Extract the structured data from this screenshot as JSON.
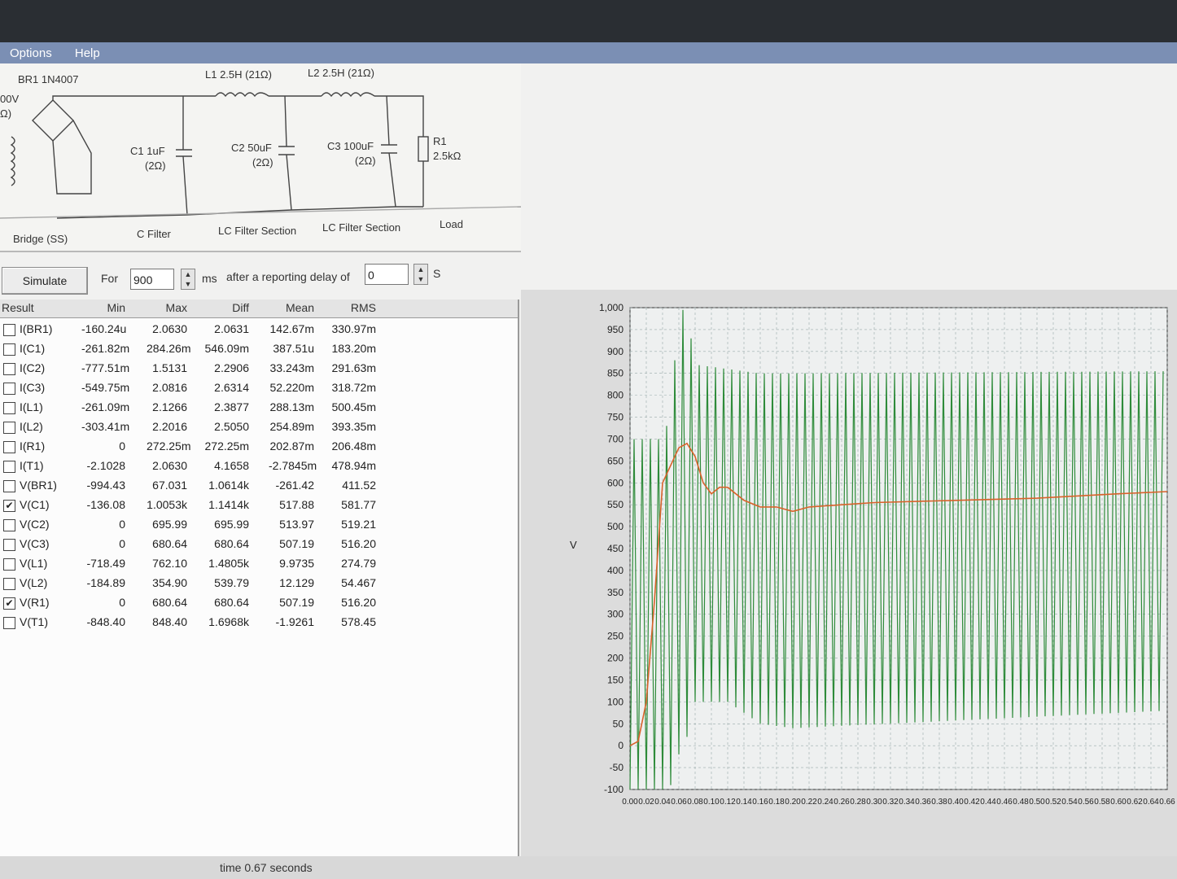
{
  "menu": {
    "items": [
      "Options",
      "Help"
    ]
  },
  "schematic": {
    "br1": "BR1 1N4007",
    "src_v": "00V",
    "src_r": "Ω)",
    "l1": "L1 2.5H (21Ω)",
    "l2": "L2 2.5H (21Ω)",
    "c1": "C1 1uF",
    "c1r": "(2Ω)",
    "c2": "C2 50uF",
    "c2r": "(2Ω)",
    "c3": "C3 100uF",
    "c3r": "(2Ω)",
    "r1": "R1",
    "r1v": "2.5kΩ",
    "sections": [
      "Bridge (SS)",
      "C Filter",
      "LC Filter Section",
      "LC Filter Section",
      "Load"
    ]
  },
  "toolbar": {
    "simulate": "Simulate",
    "for": "For",
    "duration": "900",
    "ms": "ms",
    "after": "after a reporting delay of",
    "delay": "0",
    "s": "S"
  },
  "results": {
    "headers": [
      "Result",
      "Min",
      "Max",
      "Diff",
      "Mean",
      "RMS"
    ],
    "rows": [
      {
        "name": "I(BR1)",
        "checked": false,
        "min": "-160.24u",
        "max": "2.0630",
        "diff": "2.0631",
        "mean": "142.67m",
        "rms": "330.97m"
      },
      {
        "name": "I(C1)",
        "checked": false,
        "min": "-261.82m",
        "max": "284.26m",
        "diff": "546.09m",
        "mean": "387.51u",
        "rms": "183.20m"
      },
      {
        "name": "I(C2)",
        "checked": false,
        "min": "-777.51m",
        "max": "1.5131",
        "diff": "2.2906",
        "mean": "33.243m",
        "rms": "291.63m"
      },
      {
        "name": "I(C3)",
        "checked": false,
        "min": "-549.75m",
        "max": "2.0816",
        "diff": "2.6314",
        "mean": "52.220m",
        "rms": "318.72m"
      },
      {
        "name": "I(L1)",
        "checked": false,
        "min": "-261.09m",
        "max": "2.1266",
        "diff": "2.3877",
        "mean": "288.13m",
        "rms": "500.45m"
      },
      {
        "name": "I(L2)",
        "checked": false,
        "min": "-303.41m",
        "max": "2.2016",
        "diff": "2.5050",
        "mean": "254.89m",
        "rms": "393.35m"
      },
      {
        "name": "I(R1)",
        "checked": false,
        "min": "0",
        "max": "272.25m",
        "diff": "272.25m",
        "mean": "202.87m",
        "rms": "206.48m"
      },
      {
        "name": "I(T1)",
        "checked": false,
        "min": "-2.1028",
        "max": "2.0630",
        "diff": "4.1658",
        "mean": "-2.7845m",
        "rms": "478.94m"
      },
      {
        "name": "V(BR1)",
        "checked": false,
        "min": "-994.43",
        "max": "67.031",
        "diff": "1.0614k",
        "mean": "-261.42",
        "rms": "411.52"
      },
      {
        "name": "V(C1)",
        "checked": true,
        "min": "-136.08",
        "max": "1.0053k",
        "diff": "1.1414k",
        "mean": "517.88",
        "rms": "581.77"
      },
      {
        "name": "V(C2)",
        "checked": false,
        "min": "0",
        "max": "695.99",
        "diff": "695.99",
        "mean": "513.97",
        "rms": "519.21"
      },
      {
        "name": "V(C3)",
        "checked": false,
        "min": "0",
        "max": "680.64",
        "diff": "680.64",
        "mean": "507.19",
        "rms": "516.20"
      },
      {
        "name": "V(L1)",
        "checked": false,
        "min": "-718.49",
        "max": "762.10",
        "diff": "1.4805k",
        "mean": "9.9735",
        "rms": "274.79"
      },
      {
        "name": "V(L2)",
        "checked": false,
        "min": "-184.89",
        "max": "354.90",
        "diff": "539.79",
        "mean": "12.129",
        "rms": "54.467"
      },
      {
        "name": "V(R1)",
        "checked": true,
        "min": "0",
        "max": "680.64",
        "diff": "680.64",
        "mean": "507.19",
        "rms": "516.20"
      },
      {
        "name": "V(T1)",
        "checked": false,
        "min": "-848.40",
        "max": "848.40",
        "diff": "1.6968k",
        "mean": "-1.9261",
        "rms": "578.45"
      }
    ]
  },
  "chart_data": {
    "type": "line",
    "ylabel": "V",
    "ylim": [
      -100,
      1000
    ],
    "yticks": [
      "1,000",
      "950",
      "900",
      "850",
      "800",
      "750",
      "700",
      "650",
      "600",
      "550",
      "500",
      "450",
      "400",
      "350",
      "300",
      "250",
      "200",
      "150",
      "100",
      "50",
      "0",
      "-50",
      "-100"
    ],
    "xticks": [
      "0.00",
      "0.02",
      "0.04",
      "0.06",
      "0.08",
      "0.10",
      "0.12",
      "0.14",
      "0.16",
      "0.18",
      "0.20",
      "0.22",
      "0.24",
      "0.26",
      "0.28",
      "0.30",
      "0.32",
      "0.34",
      "0.36",
      "0.38",
      "0.40",
      "0.42",
      "0.44",
      "0.46",
      "0.48",
      "0.50",
      "0.52",
      "0.54",
      "0.56",
      "0.58",
      "0.60",
      "0.62",
      "0.64",
      "0.66"
    ],
    "xlim": [
      0,
      0.66
    ],
    "grid": true,
    "series": [
      {
        "name": "V(C1)",
        "color": "#2e8b3a",
        "envelope": {
          "t": [
            0.0,
            0.04,
            0.05,
            0.06,
            0.07,
            0.08,
            0.12,
            0.16,
            0.2,
            0.66
          ],
          "high": [
            700,
            700,
            760,
            1000,
            990,
            870,
            860,
            850,
            850,
            855
          ],
          "low": [
            -100,
            -100,
            -90,
            -20,
            20,
            100,
            100,
            50,
            40,
            80
          ]
        }
      },
      {
        "name": "V(R1)",
        "color": "#d9622b",
        "x": [
          0.0,
          0.01,
          0.02,
          0.03,
          0.04,
          0.05,
          0.06,
          0.07,
          0.08,
          0.09,
          0.1,
          0.11,
          0.12,
          0.14,
          0.16,
          0.18,
          0.2,
          0.22,
          0.26,
          0.3,
          0.4,
          0.5,
          0.6,
          0.66
        ],
        "values": [
          0,
          10,
          100,
          330,
          600,
          640,
          680,
          690,
          660,
          600,
          575,
          590,
          590,
          560,
          545,
          545,
          535,
          545,
          550,
          555,
          560,
          565,
          575,
          580
        ]
      }
    ]
  },
  "status": {
    "text": "time 0.67 seconds"
  }
}
